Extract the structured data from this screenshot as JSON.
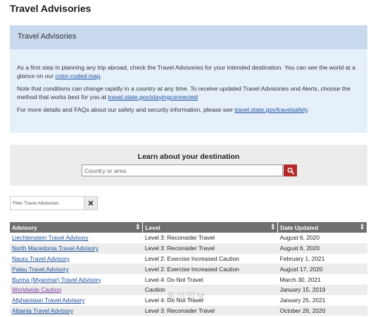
{
  "page": {
    "title": "Travel Advisories"
  },
  "info_box": {
    "heading": "Travel Advisories",
    "p1_text": "As a first step in planning any trip abroad, check the Travel Advisories for your intended destination. You can see the world at a glance on our ",
    "p1_link": "color-coded map",
    "p1_end": ".",
    "p2_text": "Note that conditions can change rapidly in a country at any time. To receive updated Travel Advisories and Alerts, choose the method that works best for you at ",
    "p2_link": "travel.state.gov/stayingconnected",
    "p3_text": "For more details and FAQs about our safety and security information, please see ",
    "p3_link": "travel.state.gov/travelsafely",
    "p3_end": "."
  },
  "destination": {
    "heading": "Learn about your destination",
    "placeholder": "Country or area",
    "search_icon": "search-icon"
  },
  "filter": {
    "placeholder": "Filter Travel Advisories",
    "clear_label": "✕"
  },
  "table": {
    "headers": [
      "Advisory",
      "Level",
      "Date Updated"
    ],
    "rows": [
      {
        "advisory": "Liechtenstein Travel Advisory",
        "level": "Level 3: Reconsider Travel",
        "date": "August 6, 2020"
      },
      {
        "advisory": "North Macedonia Travel Advisory",
        "level": "Level 3: Reconsider Travel",
        "date": "August 6, 2020"
      },
      {
        "advisory": "Nauru Travel Advisory",
        "level": "Level 2: Exercise Increased Caution",
        "date": "February 1, 2021"
      },
      {
        "advisory": "Palau Travel Advisory",
        "level": "Level 2: Exercise Increased Caution",
        "date": "August 17, 2020"
      },
      {
        "advisory": "Burma (Myanmar) Travel Advisory",
        "level": "Level 4: Do Not Travel",
        "date": "March 30, 2021"
      },
      {
        "advisory": "Worldwide Caution",
        "level": "Caution",
        "date": "January 15, 2019"
      },
      {
        "advisory": "Afghanistan Travel Advisory",
        "level": "Level 4: Do Not Travel",
        "date": "January 25, 2021"
      },
      {
        "advisory": "Albania Travel Advisory",
        "level": "Level 3: Reconsider Travel",
        "date": "October 26, 2020"
      }
    ]
  },
  "watermark": "동아일보",
  "colors": {
    "header_band": "#c9d9ee",
    "info_bg": "#e6f0fb",
    "search_button": "#b22a2a",
    "table_header": "#6f6f6f",
    "link": "#1b4f9c",
    "visited_link": "#7b3fa0"
  }
}
